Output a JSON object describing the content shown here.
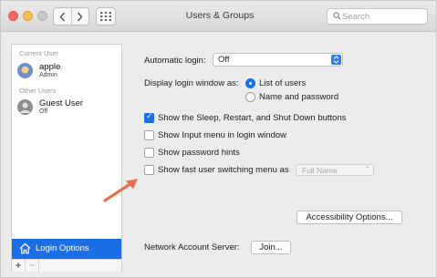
{
  "window": {
    "title": "Users & Groups"
  },
  "search": {
    "placeholder": "Search"
  },
  "sidebar": {
    "current_header": "Current User",
    "other_header": "Other Users",
    "users": [
      {
        "name": "apple",
        "role": "Admin"
      },
      {
        "name": "Guest User",
        "role": "Off"
      }
    ],
    "login_options_label": "Login Options"
  },
  "panel": {
    "automatic_login": {
      "label": "Automatic login:",
      "value": "Off"
    },
    "display_login": {
      "label": "Display login window as:",
      "options": [
        {
          "label": "List of users",
          "selected": true
        },
        {
          "label": "Name and password",
          "selected": false
        }
      ]
    },
    "checkboxes": [
      {
        "label": "Show the Sleep, Restart, and Shut Down buttons",
        "checked": true
      },
      {
        "label": "Show Input menu in login window",
        "checked": false
      },
      {
        "label": "Show password hints",
        "checked": false
      },
      {
        "label": "Show fast user switching menu as",
        "checked": false
      }
    ],
    "fast_switch_value": "Full Name",
    "accessibility_button": "Accessibility Options...",
    "network_server": {
      "label": "Network Account Server:",
      "button": "Join..."
    }
  },
  "colors": {
    "accent": "#1a6ee6",
    "annotation_arrow": "#e8704f"
  }
}
